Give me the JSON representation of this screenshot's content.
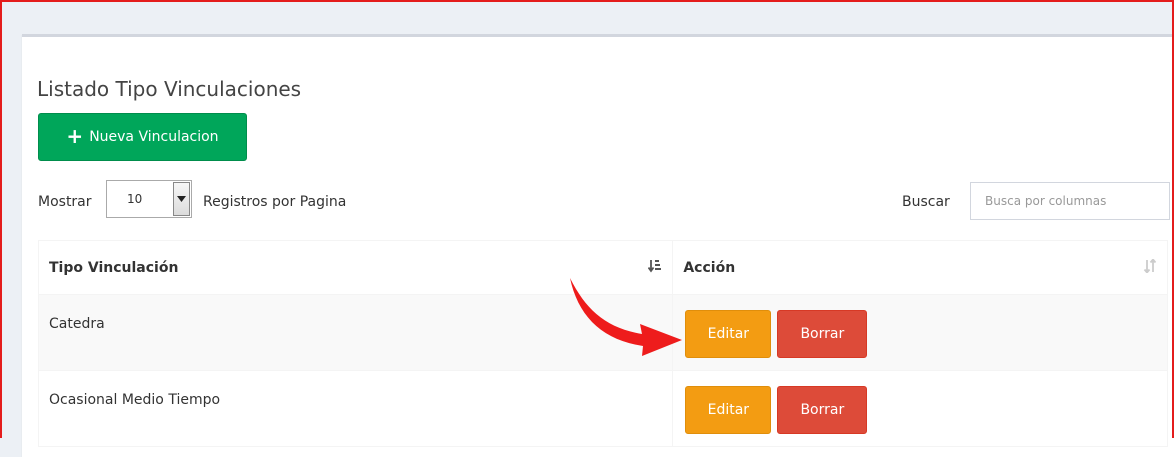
{
  "panel": {
    "title": "Listado Tipo Vinculaciones",
    "new_button_label": "Nueva Vinculacion",
    "new_button_icon": "plus-icon",
    "accent_green": "#00a65a"
  },
  "length_menu": {
    "prefix": "Mostrar",
    "selected": "10",
    "suffix": "Registros por Pagina"
  },
  "search": {
    "label": "Buscar",
    "placeholder": "Busca por columnas",
    "value": ""
  },
  "table": {
    "headers": [
      "Tipo Vinculación",
      "Acción"
    ],
    "rows": [
      {
        "tipo": "Catedra",
        "edit_label": "Editar",
        "delete_label": "Borrar"
      },
      {
        "tipo": "Ocasional Medio Tiempo",
        "edit_label": "Editar",
        "delete_label": "Borrar"
      }
    ],
    "edit_color": "#f39c12",
    "delete_color": "#dd4b39"
  },
  "annotation": {
    "arrow_color": "#ee1c1c"
  }
}
